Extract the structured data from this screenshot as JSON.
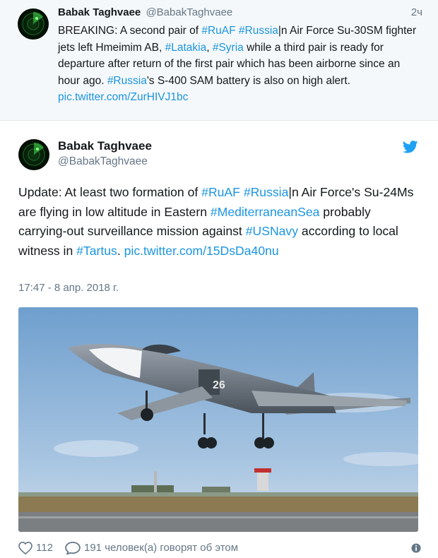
{
  "top_tweet": {
    "name": "Babak Taghvaee",
    "handle": "@BabakTaghvaee",
    "time": "2ч",
    "text": [
      {
        "t": "BREAKING: A second pair of ",
        "k": "text"
      },
      {
        "t": "#RuAF",
        "k": "tag"
      },
      {
        "t": " ",
        "k": "text"
      },
      {
        "t": "#Russia",
        "k": "tag"
      },
      {
        "t": "|n Air Force Su-30SM fighter jets left Hmeimim AB, ",
        "k": "text"
      },
      {
        "t": "#Latakia",
        "k": "tag"
      },
      {
        "t": ", ",
        "k": "text"
      },
      {
        "t": "#Syria",
        "k": "tag"
      },
      {
        "t": " while a third pair is ready for departure after return of the first pair which has been airborne since an hour ago. ",
        "k": "text"
      },
      {
        "t": "#Russia",
        "k": "tag"
      },
      {
        "t": "'s S-400 SAM battery is also on high alert. ",
        "k": "text"
      },
      {
        "t": "pic.twitter.com/ZurHIVJ1bc",
        "k": "tag"
      }
    ]
  },
  "main_tweet": {
    "name": "Babak Taghvaee",
    "handle": "@BabakTaghvaee",
    "text": [
      {
        "t": "Update: At least two formation of ",
        "k": "text"
      },
      {
        "t": "#RuAF",
        "k": "tag"
      },
      {
        "t": " ",
        "k": "text"
      },
      {
        "t": "#Russia",
        "k": "tag"
      },
      {
        "t": "|n Air Force's Su-24Ms are flying in low altitude in Eastern ",
        "k": "text"
      },
      {
        "t": "#MediterraneanSea",
        "k": "tag"
      },
      {
        "t": " probably carrying-out surveillance mission against ",
        "k": "text"
      },
      {
        "t": "#USNavy",
        "k": "tag"
      },
      {
        "t": " according to local witness in ",
        "k": "text"
      },
      {
        "t": "#Tartus",
        "k": "tag"
      },
      {
        "t": ". ",
        "k": "text"
      },
      {
        "t": "pic.twitter.com/15DsDa40nu",
        "k": "tag"
      }
    ],
    "date": "17:47 - 8 апр. 2018 г.",
    "photo_alt": "Su-24M jet taking off",
    "aircraft_number": "26",
    "likes": "112",
    "replies_label": "191 человек(а) говорят об этом"
  },
  "colors": {
    "link": "#1b95e0",
    "muted": "#657786",
    "text": "#14171a"
  },
  "icons": {
    "avatar": "radar-avatar-icon",
    "twitter": "twitter-bird-icon",
    "like": "heart-icon",
    "reply": "speech-bubble-icon",
    "info": "info-icon"
  }
}
